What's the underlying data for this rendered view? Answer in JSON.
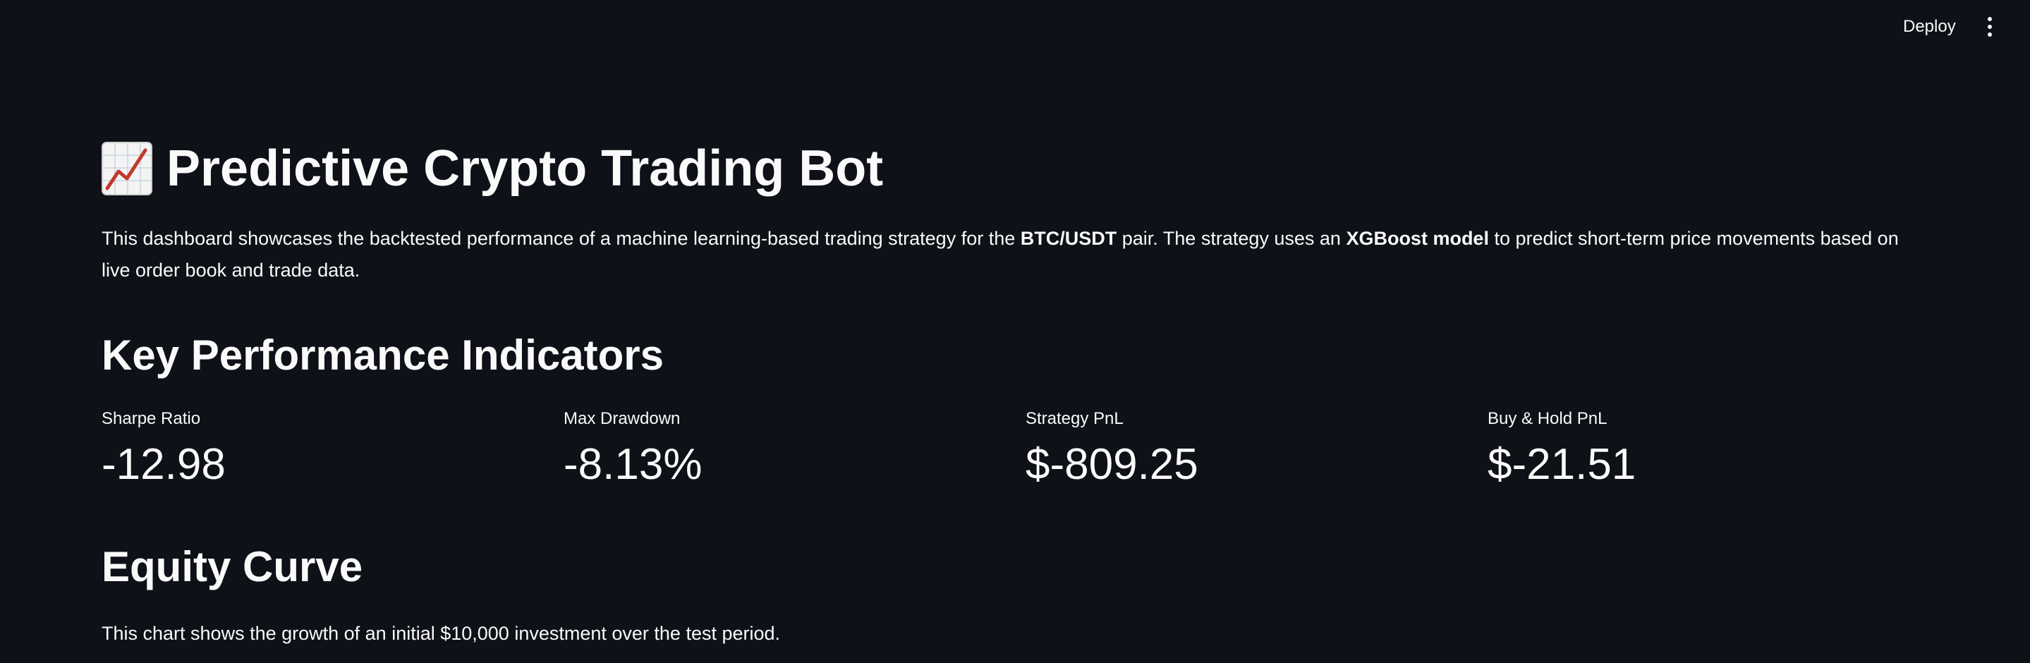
{
  "header": {
    "deploy_label": "Deploy",
    "menu_icon": "vertical-ellipsis-icon"
  },
  "page": {
    "title_icon": "chart-increasing-icon",
    "title": "Predictive Crypto Trading Bot",
    "intro": {
      "part1": "This dashboard showcases the backtested performance of a machine learning-based trading strategy for the ",
      "bold1": "BTC/USDT",
      "part2": " pair. The strategy uses an ",
      "bold2": "XGBoost model",
      "part3": " to predict short-term price movements based on live order book and trade data."
    }
  },
  "kpi": {
    "heading": "Key Performance Indicators",
    "metrics": [
      {
        "label": "Sharpe Ratio",
        "value": "-12.98"
      },
      {
        "label": "Max Drawdown",
        "value": "-8.13%"
      },
      {
        "label": "Strategy PnL",
        "value": "$-809.25"
      },
      {
        "label": "Buy & Hold PnL",
        "value": "$-21.51"
      }
    ]
  },
  "equity": {
    "heading": "Equity Curve",
    "caption": "This chart shows the growth of an initial $10,000 investment over the test period."
  },
  "colors": {
    "background": "#0e1117",
    "text": "#fafafa",
    "icon_line": "#c0392b"
  }
}
